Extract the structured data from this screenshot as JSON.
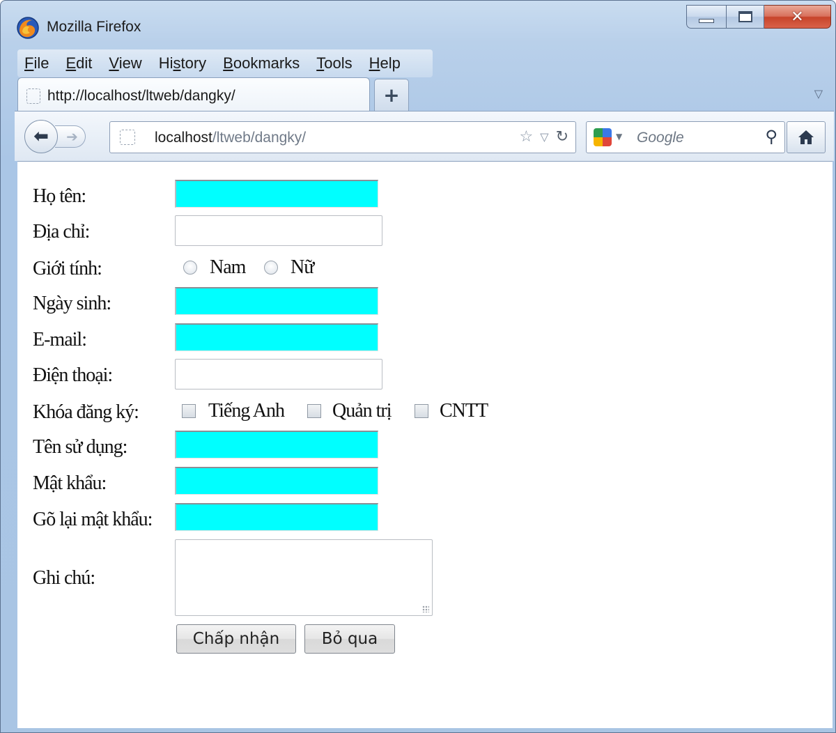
{
  "window": {
    "title": "Mozilla Firefox"
  },
  "menubar": {
    "items": [
      {
        "label_first": "F",
        "label_rest": "ile"
      },
      {
        "label_first": "E",
        "label_rest": "dit"
      },
      {
        "label_first": "V",
        "label_rest": "iew"
      },
      {
        "label_pre": "Hi",
        "label_first": "s",
        "label_rest": "tory"
      },
      {
        "label_first": "B",
        "label_rest": "ookmarks"
      },
      {
        "label_first": "T",
        "label_rest": "ools"
      },
      {
        "label_first": "H",
        "label_rest": "elp"
      }
    ]
  },
  "tab": {
    "title": "http://localhost/ltweb/dangky/"
  },
  "newtab": {
    "label": "+"
  },
  "navbar": {
    "url_host": "localhost",
    "url_path": "/ltweb/dangky/",
    "search_placeholder": "Google"
  },
  "form": {
    "ho_ten": "Họ tên:",
    "dia_chi": "Địa chỉ:",
    "gioi_tinh": "Giới tính:",
    "gender_options": [
      "Nam",
      "Nữ"
    ],
    "ngay_sinh": "Ngày sinh:",
    "email": "E-mail:",
    "dien_thoai": "Điện thoại:",
    "khoa_dang_ky": "Khóa đăng ký:",
    "course_options": [
      "Tiếng Anh",
      "Quản trị",
      "CNTT"
    ],
    "ten_su_dung": "Tên sử dụng:",
    "mat_khau": "Mật khẩu:",
    "go_lai_mat_khau": "Gõ lại mật khẩu:",
    "ghi_chu": "Ghi chú:",
    "submit": "Chấp nhận",
    "reset": "Bỏ qua"
  },
  "colors": {
    "required_field": "#00ffff",
    "close_button": "#c7432a"
  },
  "icons": [
    "firefox-logo-icon",
    "minimize-icon",
    "maximize-icon",
    "close-icon",
    "back-arrow-icon",
    "forward-arrow-icon",
    "page-favicon-icon",
    "bookmark-star-icon",
    "dropdown-arrow-icon",
    "reload-icon",
    "google-logo-icon",
    "magnifier-icon",
    "home-icon",
    "resize-grip-icon"
  ]
}
